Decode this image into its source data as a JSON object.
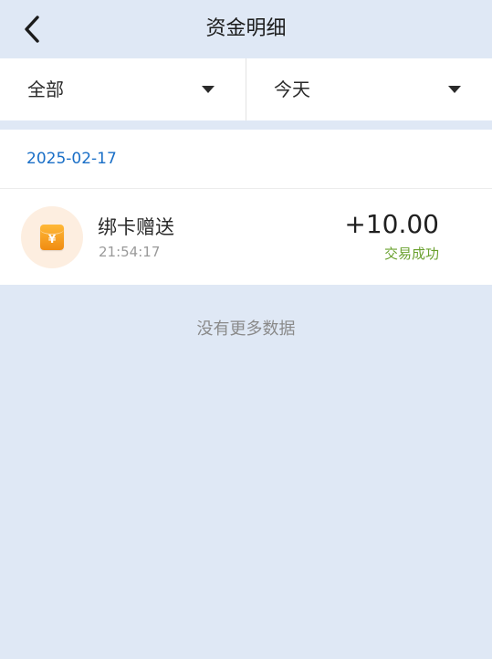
{
  "header": {
    "title": "资金明细",
    "back_icon": "chevron-left-icon"
  },
  "filters": {
    "type_label": "全部",
    "time_label": "今天",
    "dropdown_icon": "caret-down-icon"
  },
  "records": {
    "date": "2025-02-17",
    "items": [
      {
        "title": "绑卡赠送",
        "time": "21:54:17",
        "amount": "+10.00",
        "status": "交易成功",
        "icon": "red-envelope-icon",
        "icon_symbol": "¥"
      }
    ]
  },
  "footer": {
    "no_more": "没有更多数据"
  },
  "colors": {
    "background": "#dfe8f5",
    "date_text": "#1a6fc7",
    "status_success": "#6aa12f",
    "icon_orange": "#f08c12"
  }
}
